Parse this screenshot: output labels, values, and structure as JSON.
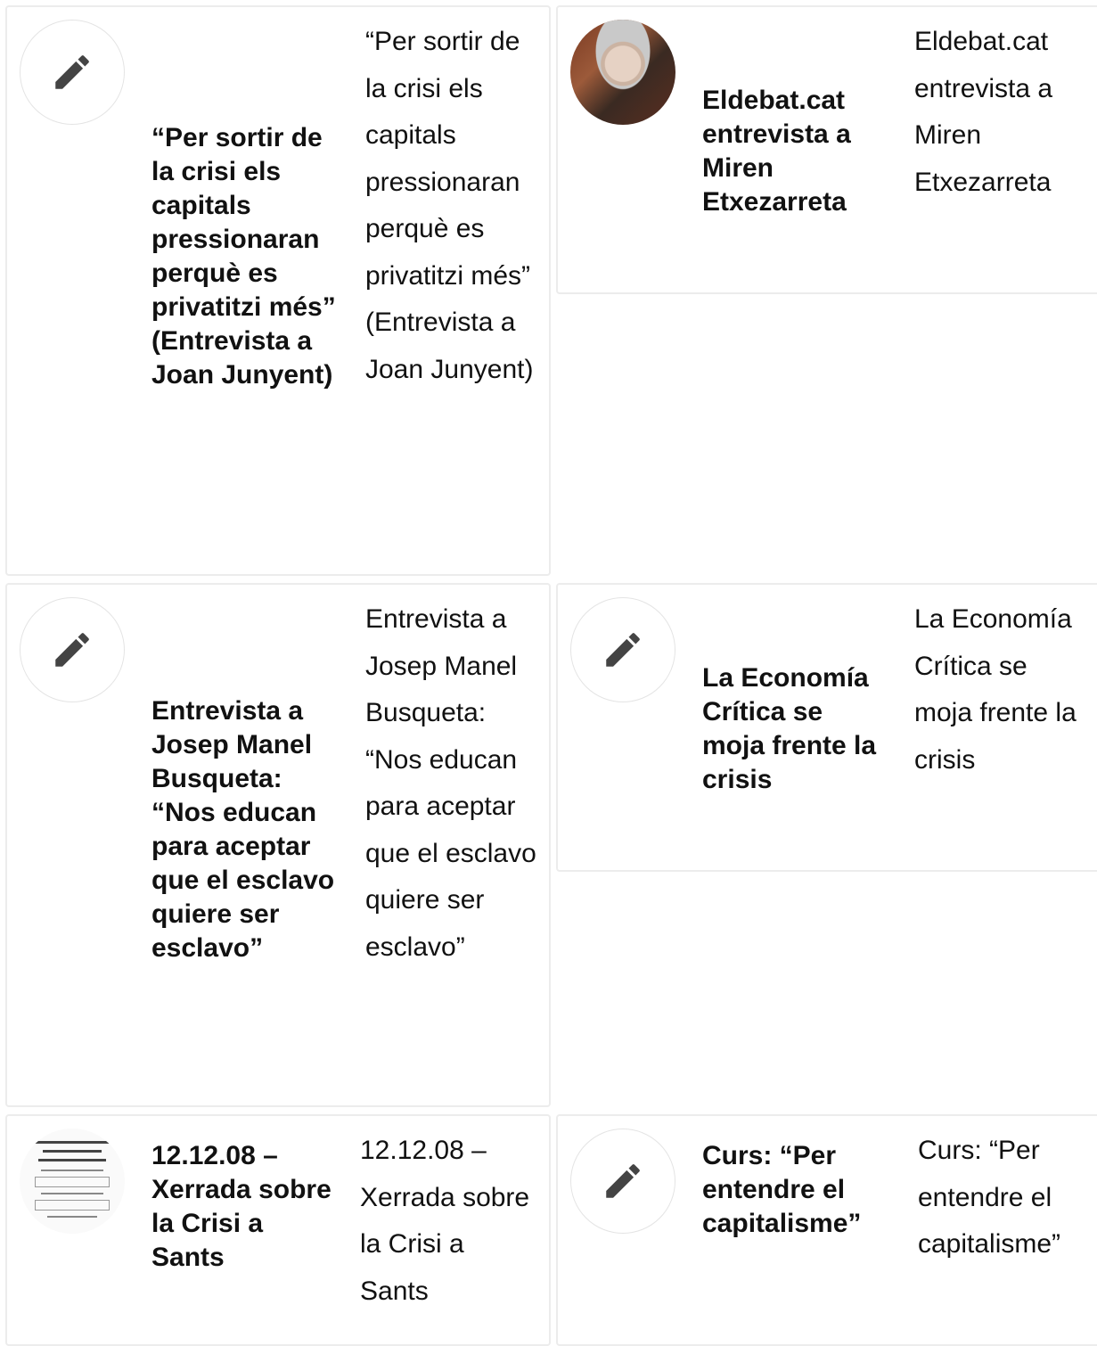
{
  "cards": [
    {
      "title": "“Per sortir de la crisi els capitals pressionaran perquè es privatitzi més” (Entrevista a Joan Junyent)",
      "excerpt": "“Per sortir de la crisi els capitals pressionaran perquè es privatitzi més” (Entrevista a Joan Junyent)",
      "icon": "pencil-icon"
    },
    {
      "title": "Eldebat.cat entrevista a Miren Etxezarreta",
      "excerpt": "Eldebat.cat entrevista a Miren Etxezarreta",
      "icon": "portrait-photo"
    },
    {
      "title": "Entrevista a Josep Manel Busqueta: “Nos educan para aceptar que el esclavo quiere ser esclavo”",
      "excerpt": "Entrevista a Josep Manel Busqueta: “Nos educan para aceptar que el esclavo quiere ser esclavo”",
      "icon": "pencil-icon"
    },
    {
      "title": "La Economía Crítica se moja frente la crisis",
      "excerpt": "La Economía Crítica se moja frente la crisis",
      "icon": "pencil-icon"
    },
    {
      "title": "12.12.08 – Xerrada sobre la Crisi a Sants",
      "excerpt": "12.12.08 – Xerrada sobre la Crisi a Sants",
      "icon": "poster-thumbnail"
    },
    {
      "title": "Curs: “Per entendre el capitalisme”",
      "excerpt": "Curs: “Per entendre el capitalisme”",
      "icon": "pencil-icon"
    }
  ],
  "colors": {
    "border": "#ececec",
    "text": "#111111",
    "icon": "#444444"
  }
}
